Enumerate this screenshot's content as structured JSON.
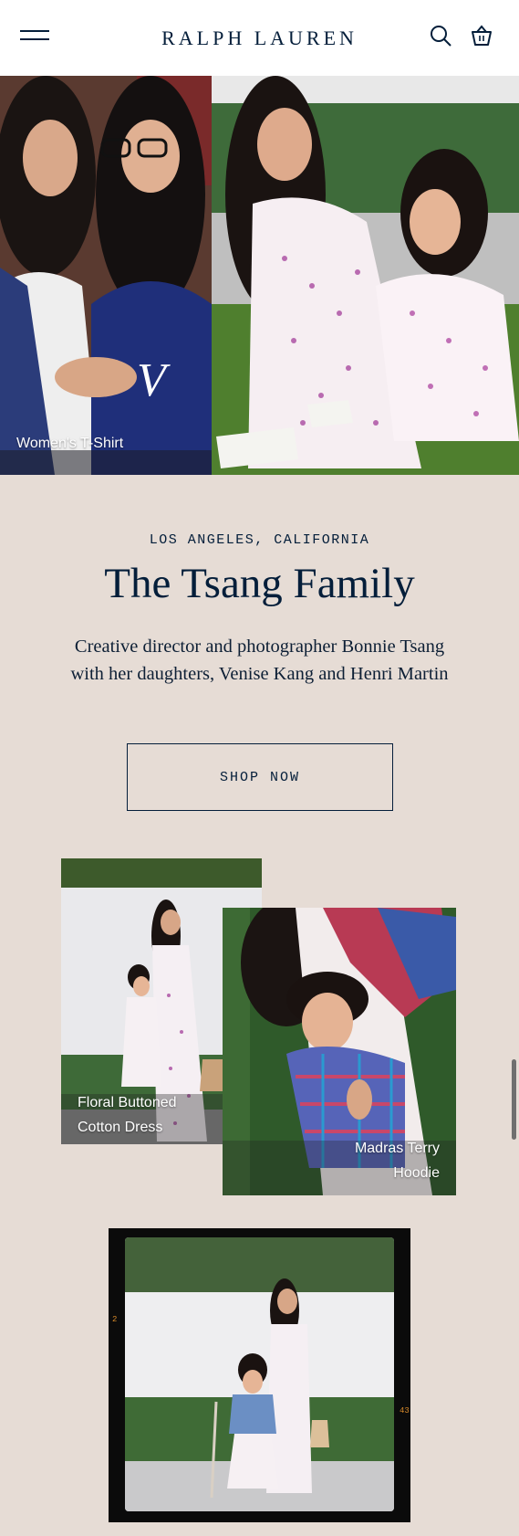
{
  "header": {
    "brand": "RALPH LAUREN",
    "menu_icon": "hamburger-menu-icon",
    "search_icon": "search-icon",
    "bag_icon": "shopping-bag-icon"
  },
  "hero": {
    "left_caption": "Women's T-Shirt"
  },
  "story": {
    "location": "LOS ANGELES, CALIFORNIA",
    "title": "The Tsang Family",
    "description": "Creative director and photographer Bonnie Tsang with her daughters, Venise Kang and Henri Martin",
    "cta": "SHOP NOW"
  },
  "products": [
    {
      "caption_line1": "Floral Buttoned",
      "caption_line2": "Cotton Dress"
    },
    {
      "caption_line1": "Madras Terry",
      "caption_line2": "Hoodie"
    }
  ],
  "film": {
    "mark_top": "2",
    "mark_right": "43"
  },
  "colors": {
    "navy": "#041e3a",
    "background": "#e6dcd5",
    "header_bg": "#ffffff"
  }
}
